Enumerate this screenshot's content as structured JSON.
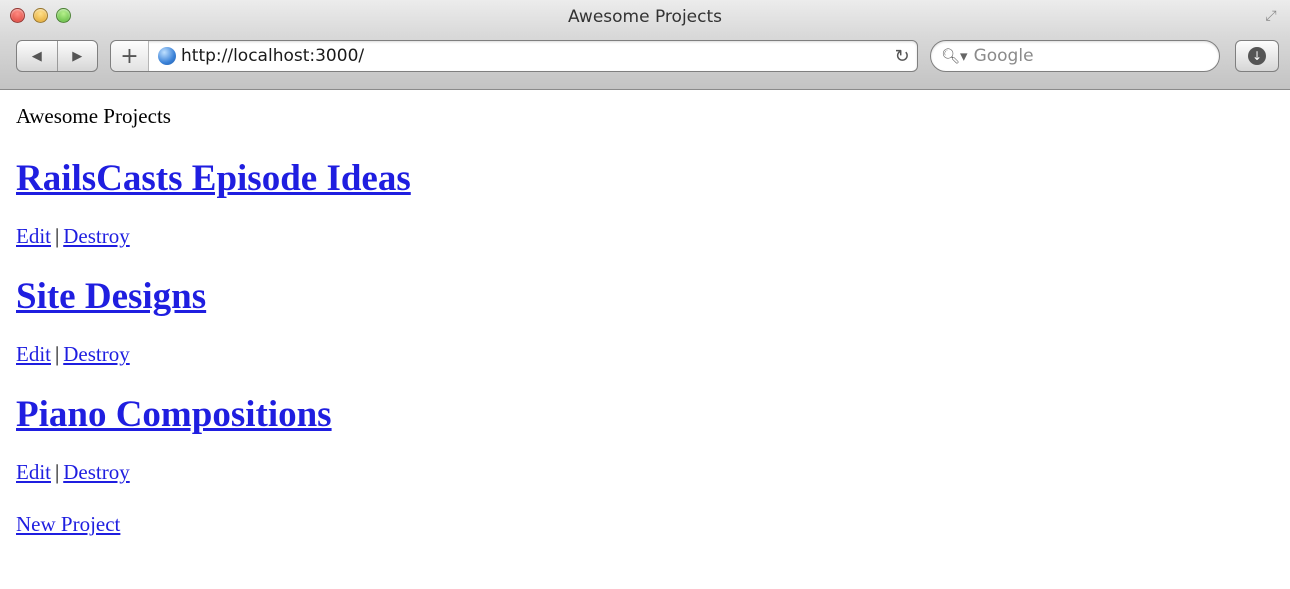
{
  "window": {
    "title": "Awesome Projects"
  },
  "toolbar": {
    "back_icon": "back-arrow-icon",
    "forward_icon": "forward-arrow-icon",
    "add_label": "+",
    "url": "http://localhost:3000/",
    "reload_icon": "reload-icon",
    "search_placeholder": "Google",
    "download_icon": "download-icon"
  },
  "page": {
    "title": "Awesome Projects",
    "projects": [
      {
        "name": "RailsCasts Episode Ideas",
        "edit_label": "Edit",
        "separator": "|",
        "destroy_label": "Destroy"
      },
      {
        "name": "Site Designs",
        "edit_label": "Edit",
        "separator": "|",
        "destroy_label": "Destroy"
      },
      {
        "name": "Piano Compositions",
        "edit_label": "Edit",
        "separator": "|",
        "destroy_label": "Destroy"
      }
    ],
    "new_project_label": "New Project"
  },
  "colors": {
    "link": "#1f1ee0",
    "text": "#000000",
    "chrome_top": "#ececec",
    "chrome_bottom": "#c3c3c3"
  }
}
